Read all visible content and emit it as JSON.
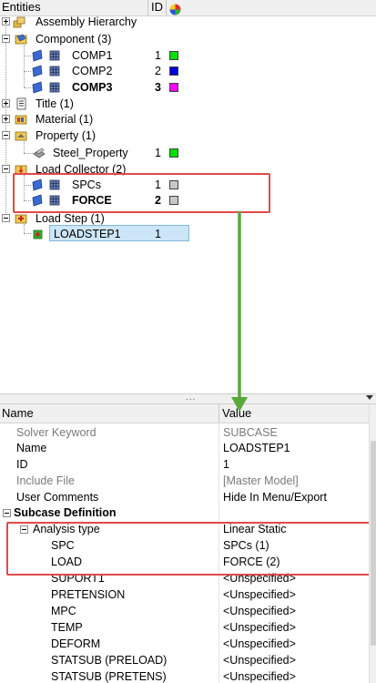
{
  "tree": {
    "header": {
      "entities": "Entities",
      "id": "ID"
    },
    "rows": [
      {
        "label": "Assembly Hierarchy"
      },
      {
        "label": "Component (3)"
      },
      {
        "label": "COMP1",
        "id": "1",
        "color": "#00e000"
      },
      {
        "label": "COMP2",
        "id": "2",
        "color": "#0000d8"
      },
      {
        "label": "COMP3",
        "id": "3",
        "color": "#ff00ff"
      },
      {
        "label": "Title (1)"
      },
      {
        "label": "Material (1)"
      },
      {
        "label": "Property (1)"
      },
      {
        "label": "Steel_Property",
        "id": "1",
        "color": "#00e000"
      },
      {
        "label": "Load Collector (2)"
      },
      {
        "label": "SPCs",
        "id": "1",
        "color": "#c8c8c8"
      },
      {
        "label": "FORCE",
        "id": "2",
        "color": "#c8c8c8"
      },
      {
        "label": "Load Step (1)"
      },
      {
        "label": "LOADSTEP1",
        "id": "1"
      }
    ]
  },
  "splitter": {
    "grip": "..."
  },
  "properties": {
    "header": {
      "name": "Name",
      "value": "Value"
    },
    "rows": [
      {
        "name": "Solver Keyword",
        "value": "SUBCASE"
      },
      {
        "name": "Name",
        "value": "LOADSTEP1"
      },
      {
        "name": "ID",
        "value": "1"
      },
      {
        "name": "Include File",
        "value": "[Master Model]"
      },
      {
        "name": "User Comments",
        "value": "Hide In Menu/Export"
      },
      {
        "name": "Subcase Definition",
        "value": ""
      },
      {
        "name": "Analysis type",
        "value": "Linear Static"
      },
      {
        "name": "SPC",
        "value": "SPCs (1)"
      },
      {
        "name": "LOAD",
        "value": "FORCE (2)"
      },
      {
        "name": "SUPORT1",
        "value": "<Unspecified>"
      },
      {
        "name": "PRETENSION",
        "value": "<Unspecified>"
      },
      {
        "name": "MPC",
        "value": "<Unspecified>"
      },
      {
        "name": "TEMP",
        "value": "<Unspecified>"
      },
      {
        "name": "DEFORM",
        "value": "<Unspecified>"
      },
      {
        "name": "STATSUB (PRELOAD)",
        "value": "<Unspecified>"
      },
      {
        "name": "STATSUB (PRETENS)",
        "value": "<Unspecified>"
      }
    ]
  },
  "colors": {
    "highlight": "#e04a4a",
    "arrow": "#5aa83a",
    "selection": "#cde6f7"
  }
}
